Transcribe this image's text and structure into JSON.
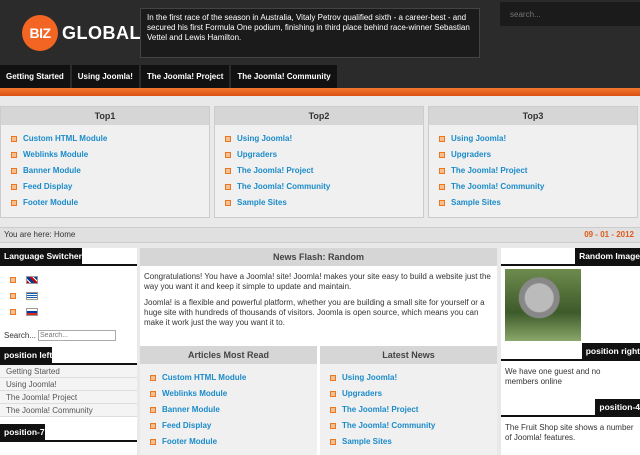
{
  "header": {
    "logo_short": "BIZ",
    "logo_rest": "GLOBAL",
    "newsflash": "In the first race of the season in Australia, Vitaly Petrov qualified sixth - a career-best - and secured his first Formula One podium, finishing in third place behind race-winner Sebastian Vettel and Lewis Hamilton.",
    "search_placeholder": "search..."
  },
  "nav": [
    "Getting Started",
    "Using Joomla!",
    "The Joomla! Project",
    "The Joomla! Community"
  ],
  "top": [
    {
      "title": "Top1",
      "items": [
        "Custom HTML Module",
        "Weblinks Module",
        "Banner Module",
        "Feed Display",
        "Footer Module"
      ]
    },
    {
      "title": "Top2",
      "items": [
        "Using Joomla!",
        "Upgraders",
        "The Joomla! Project",
        "The Joomla! Community",
        "Sample Sites"
      ]
    },
    {
      "title": "Top3",
      "items": [
        "Using Joomla!",
        "Upgraders",
        "The Joomla! Project",
        "The Joomla! Community",
        "Sample Sites"
      ]
    }
  ],
  "breadcrumb": {
    "text": "You are here: Home",
    "date": "09 - 01 - 2012"
  },
  "left": {
    "lang_title": "Language Switcher",
    "search_label": "Search...",
    "search_placeholder": "Search...",
    "position_left": "position left",
    "menu": [
      "Getting Started",
      "Using Joomla!",
      "The Joomla! Project",
      "The Joomla! Community"
    ],
    "position7": "position-7"
  },
  "center": {
    "newsflash_title": "News Flash: Random",
    "para1": "Congratulations! You have a Joomla! site! Joomla! makes your site easy to build a website just the way you want it and keep it simple to update and maintain.",
    "para2": "Joomla! is a flexible and powerful platform, whether you are building a small site for yourself or a huge site with hundreds of thousands of visitors. Joomla is open source, which means you can make it work just the way you want it to.",
    "most_read_title": "Articles Most Read",
    "most_read": [
      "Custom HTML Module",
      "Weblinks Module",
      "Banner Module",
      "Feed Display",
      "Footer Module"
    ],
    "latest_title": "Latest News",
    "latest": [
      "Using Joomla!",
      "Upgraders",
      "The Joomla! Project",
      "The Joomla! Community",
      "Sample Sites"
    ]
  },
  "right": {
    "random_image": "Random Image",
    "position_right": "position right",
    "guests": "We have one guest and no members online",
    "position4": "position-4",
    "fruit": "The Fruit Shop site shows a number of Joomla! features."
  },
  "colors": {
    "accent": "#f26522",
    "link": "#1a8bc9",
    "header_bg": "#2b2b2b"
  }
}
